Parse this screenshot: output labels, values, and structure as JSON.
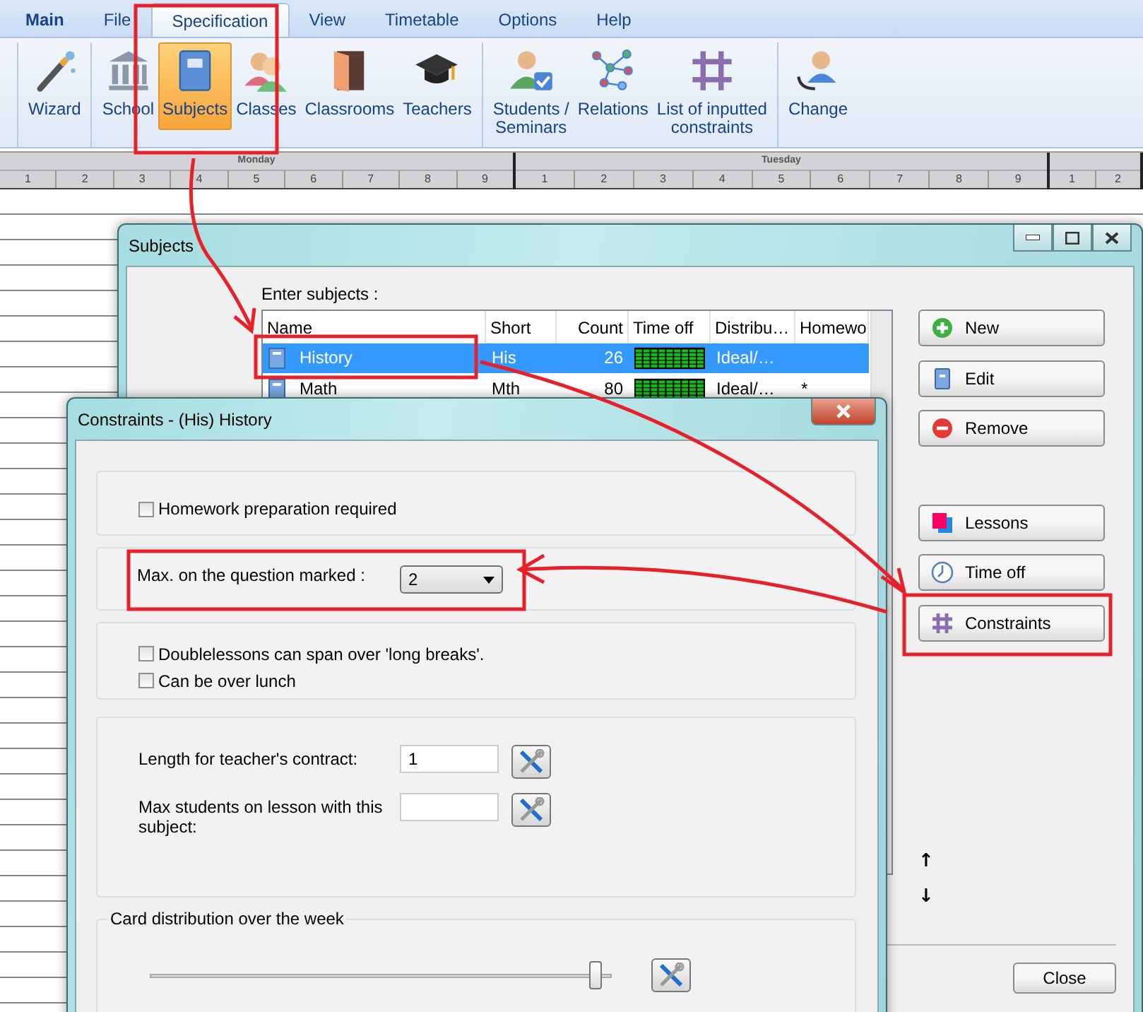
{
  "menu_tabs": [
    {
      "label": "Main",
      "kind": "app",
      "selected": false
    },
    {
      "label": "File",
      "kind": "tab",
      "selected": false
    },
    {
      "label": "Specification",
      "kind": "tab",
      "selected": true
    },
    {
      "label": "View",
      "kind": "tab",
      "selected": false
    },
    {
      "label": "Timetable",
      "kind": "tab",
      "selected": false
    },
    {
      "label": "Options",
      "kind": "tab",
      "selected": false
    },
    {
      "label": "Help",
      "kind": "tab",
      "selected": false
    }
  ],
  "ribbon_groups": [
    [
      {
        "label": "Wizard",
        "selected": false
      }
    ],
    [
      {
        "label": "School",
        "selected": false
      },
      {
        "label": "Subjects",
        "selected": true
      },
      {
        "label": "Classes",
        "selected": false
      },
      {
        "label": "Classrooms",
        "selected": false
      },
      {
        "label": "Teachers",
        "selected": false
      }
    ],
    [
      {
        "label": "Students /\nSeminars",
        "selected": false
      },
      {
        "label": "Relations",
        "selected": false
      },
      {
        "label": "List of inputted\nconstraints",
        "selected": false
      }
    ],
    [
      {
        "label": "Change",
        "selected": false
      }
    ]
  ],
  "timetable": {
    "days": [
      {
        "label": "Monday",
        "periods": [
          "1",
          "2",
          "3",
          "4",
          "5",
          "6",
          "7",
          "8",
          "9"
        ]
      },
      {
        "label": "Tuesday",
        "periods": [
          "1",
          "2",
          "3",
          "4",
          "5",
          "6",
          "7",
          "8",
          "9"
        ]
      },
      {
        "periods": [
          "1",
          "2"
        ]
      }
    ]
  },
  "subjects_window": {
    "title": "Subjects",
    "list_label": "Enter subjects :",
    "columns": [
      "Name",
      "Short",
      "Count",
      "Time off",
      "Distribu…",
      "Homewo"
    ],
    "rows": [
      {
        "name": "History",
        "short": "His",
        "count": "26",
        "distribution": "Ideal/…",
        "selected": true
      },
      {
        "name": "Math",
        "short": "Mth",
        "count": "80",
        "distribution": "Ideal/…",
        "homework": "*",
        "selected": false
      }
    ],
    "buttons": [
      "New",
      "Edit",
      "Remove",
      "Lessons",
      "Time off",
      "Constraints"
    ],
    "move_buttons": [
      "↑",
      "↓"
    ],
    "close_button": "Close"
  },
  "constraints_dialog": {
    "title": "Constraints - (His) History",
    "homework": {
      "label": "Homework preparation required",
      "checked": false
    },
    "max_question": {
      "label": "Max. on the question marked :",
      "value": "2"
    },
    "double_lessons": [
      {
        "label": "Doublelessons can span over 'long breaks'.",
        "checked": false
      },
      {
        "label": "Can be over lunch",
        "checked": false
      }
    ],
    "fields": [
      {
        "label": "Length for teacher's contract:",
        "value": "1"
      },
      {
        "label": "Max students on lesson with this subject:"
      }
    ],
    "card_distribution": {
      "legend": "Card distribution over the week",
      "level": 0.97
    }
  }
}
